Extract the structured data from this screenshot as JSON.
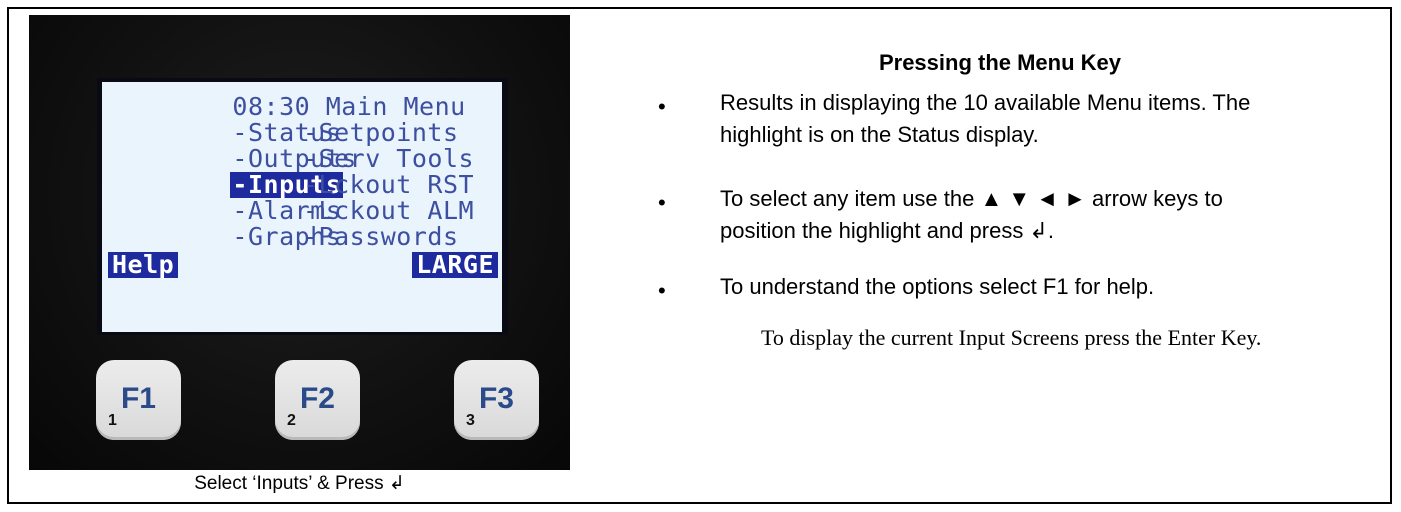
{
  "device": {
    "lcd": {
      "rows": [
        {
          "col1": "08:30 Main Menu",
          "col2": ""
        },
        {
          "col1": "-Status",
          "col2": "-Setpoints"
        },
        {
          "col1": "-Outputs",
          "col2": "-Serv Tools"
        },
        {
          "col1": "-Inputs",
          "col2": "-Lckout RST"
        },
        {
          "col1": "-Alarms",
          "col2": "-Lckout ALM"
        },
        {
          "col1": "-Graphs",
          "col2": "-Passwords"
        }
      ],
      "softkey_left": "Help",
      "softkey_right": "LARGE"
    },
    "fkeys": [
      {
        "label": "F1",
        "num": "1"
      },
      {
        "label": "F2",
        "num": "2"
      },
      {
        "label": "F3",
        "num": "3"
      }
    ]
  },
  "caption": "Select ‘Inputs’ & Press ↲",
  "panel": {
    "heading": "Pressing the Menu Key",
    "bullets": [
      "Results in displaying the 10 available Menu items. The highlight is on the Status display.",
      "To select any item use the ▲ ▼ ◄ ► arrow keys to position the highlight and press ↲.",
      "To understand the options select F1 for help."
    ],
    "bullet_symbol": "•",
    "note": "To display the current Input Screens press the Enter Key."
  },
  "colors": {
    "lcd_background": "#eaf4fc",
    "lcd_text": "#3d4fa0",
    "highlight": "#1d2b9e"
  }
}
